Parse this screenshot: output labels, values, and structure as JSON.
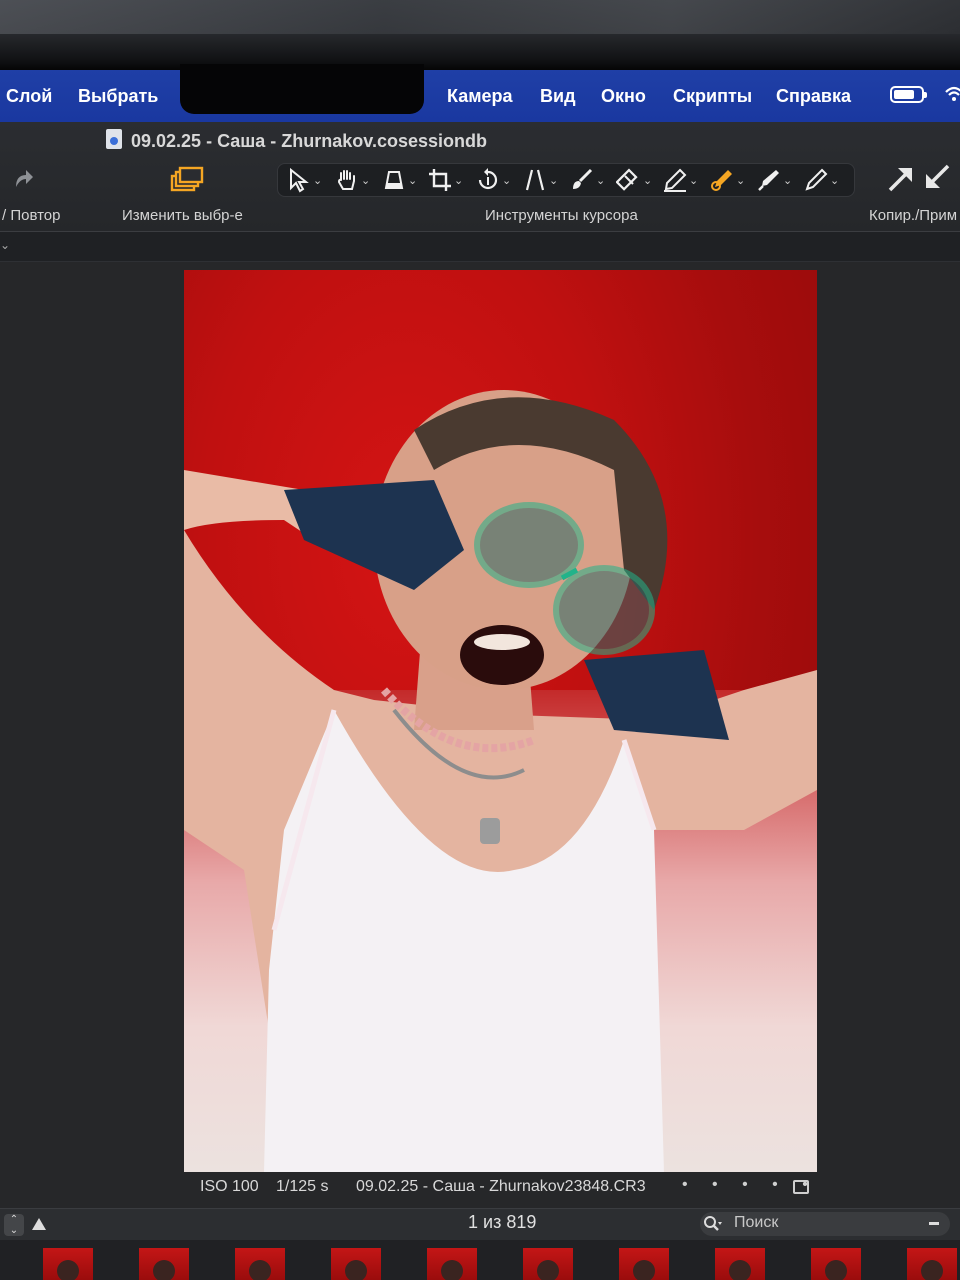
{
  "menubar": {
    "items": [
      "Слой",
      "Выбрать",
      "Камера",
      "Вид",
      "Окно",
      "Скрипты",
      "Справка"
    ]
  },
  "window": {
    "title": "09.02.25 - Саша - Zhurnakov.cosessiondb"
  },
  "toolbar": {
    "redo_label": "/ Повтор",
    "change_selection_label": "Изменить выбр-е",
    "cursor_tools_label": "Инструменты курсора",
    "copy_apply_label": "Копир./Прим",
    "tools": [
      "select-icon",
      "hand-icon",
      "loupe-icon",
      "crop-icon",
      "rotate-icon",
      "keystone-icon",
      "brush-icon",
      "eraser-icon",
      "gradient-mask-icon",
      "heal-icon",
      "color-picker-icon",
      "annotate-icon"
    ]
  },
  "viewer": {
    "iso": "ISO 100",
    "shutter": "1/125 s",
    "filename": "09.02.25 - Саша - Zhurnakov23848.CR3",
    "dots": "• • • • •"
  },
  "browser": {
    "counter": "1 из 819",
    "search_placeholder": "Поиск"
  },
  "colors": {
    "menubar": "#1d3ca3",
    "toolbar_bg": "#2a2c30",
    "accent_orange": "#f5a623",
    "photo_red": "#c01010"
  }
}
